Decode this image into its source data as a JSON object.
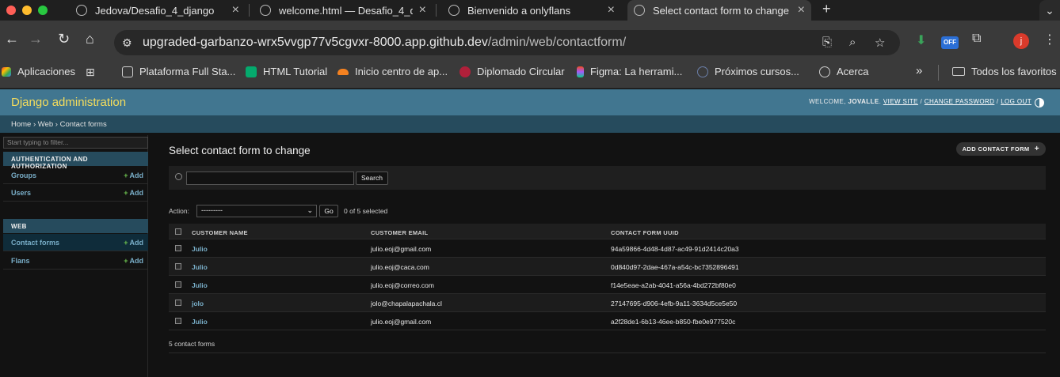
{
  "browser": {
    "tabs": [
      {
        "label": "Jedova/Desafio_4_django"
      },
      {
        "label": "welcome.html — Desafio_4_d"
      },
      {
        "label": "Bienvenido a onlyflans"
      },
      {
        "label": "Select contact form to change"
      }
    ],
    "new_tab": "+",
    "url_host": "upgraded-garbanzo-wrx5vvgp77v5cgvxr-8000.app.github.dev",
    "url_path": "/admin/web/contactform/",
    "extension_badge": "OFF",
    "profile_initial": "j",
    "bookmarks": [
      {
        "label": "Aplicaciones"
      },
      {
        "label": "Plataforma Full Sta..."
      },
      {
        "label": "HTML Tutorial"
      },
      {
        "label": "Inicio centro de ap..."
      },
      {
        "label": "Diplomado Circular"
      },
      {
        "label": "Figma: La herrami..."
      },
      {
        "label": "Próximos cursos..."
      },
      {
        "label": "Acerca"
      },
      {
        "label": "Todos los favoritos"
      }
    ],
    "bookmarks_overflow": "»"
  },
  "admin": {
    "brand": "Django administration",
    "welcome": "WELCOME, ",
    "username": "JOVALLE",
    "view_site": "VIEW SITE",
    "change_password": "CHANGE PASSWORD",
    "log_out": "LOG OUT",
    "sep": " / ",
    "breadcrumbs": "Home › Web › Contact forms"
  },
  "sidebar": {
    "filter_placeholder": "Start typing to filter...",
    "apps": [
      {
        "caption": "AUTHENTICATION AND AUTHORIZATION",
        "models": [
          {
            "label": "Groups",
            "add": "Add"
          },
          {
            "label": "Users",
            "add": "Add"
          }
        ]
      },
      {
        "caption": "WEB",
        "models": [
          {
            "label": "Contact forms",
            "add": "Add"
          },
          {
            "label": "Flans",
            "add": "Add"
          }
        ]
      }
    ]
  },
  "main": {
    "title": "Select contact form to change",
    "add_button": "ADD CONTACT FORM",
    "search_button": "Search",
    "action_label": "Action:",
    "action_selected": "---------",
    "go_button": "Go",
    "selection_counter": "0 of 5 selected",
    "columns": [
      "CUSTOMER NAME",
      "CUSTOMER EMAIL",
      "CONTACT FORM UUID"
    ],
    "rows": [
      {
        "name": "Julio",
        "email": "julio.eoj@gmail.com",
        "uuid": "94a59866-4d48-4d87-ac49-91d2414c20a3"
      },
      {
        "name": "Julio",
        "email": "julio.eoj@caca.com",
        "uuid": "0d840d97-2dae-467a-a54c-bc7352896491"
      },
      {
        "name": "Julio",
        "email": "julio.eoj@correo.com",
        "uuid": "f14e5eae-a2ab-4041-a56a-4bd272bf80e0"
      },
      {
        "name": "jolo",
        "email": "jolo@chapalapachala.cl",
        "uuid": "27147695-d906-4efb-9a11-3634d5ce5e50"
      },
      {
        "name": "Julio",
        "email": "julio.eoj@gmail.com",
        "uuid": "a2f28de1-6b13-46ee-b850-fbe0e977520c"
      }
    ],
    "paginator": "5 contact forms"
  },
  "colors": {
    "header": "#417690",
    "breadcrumbs": "#264b5d",
    "brand": "#f5dd5d",
    "link": "#79aec8",
    "add_plus": "#6bbf4e"
  }
}
